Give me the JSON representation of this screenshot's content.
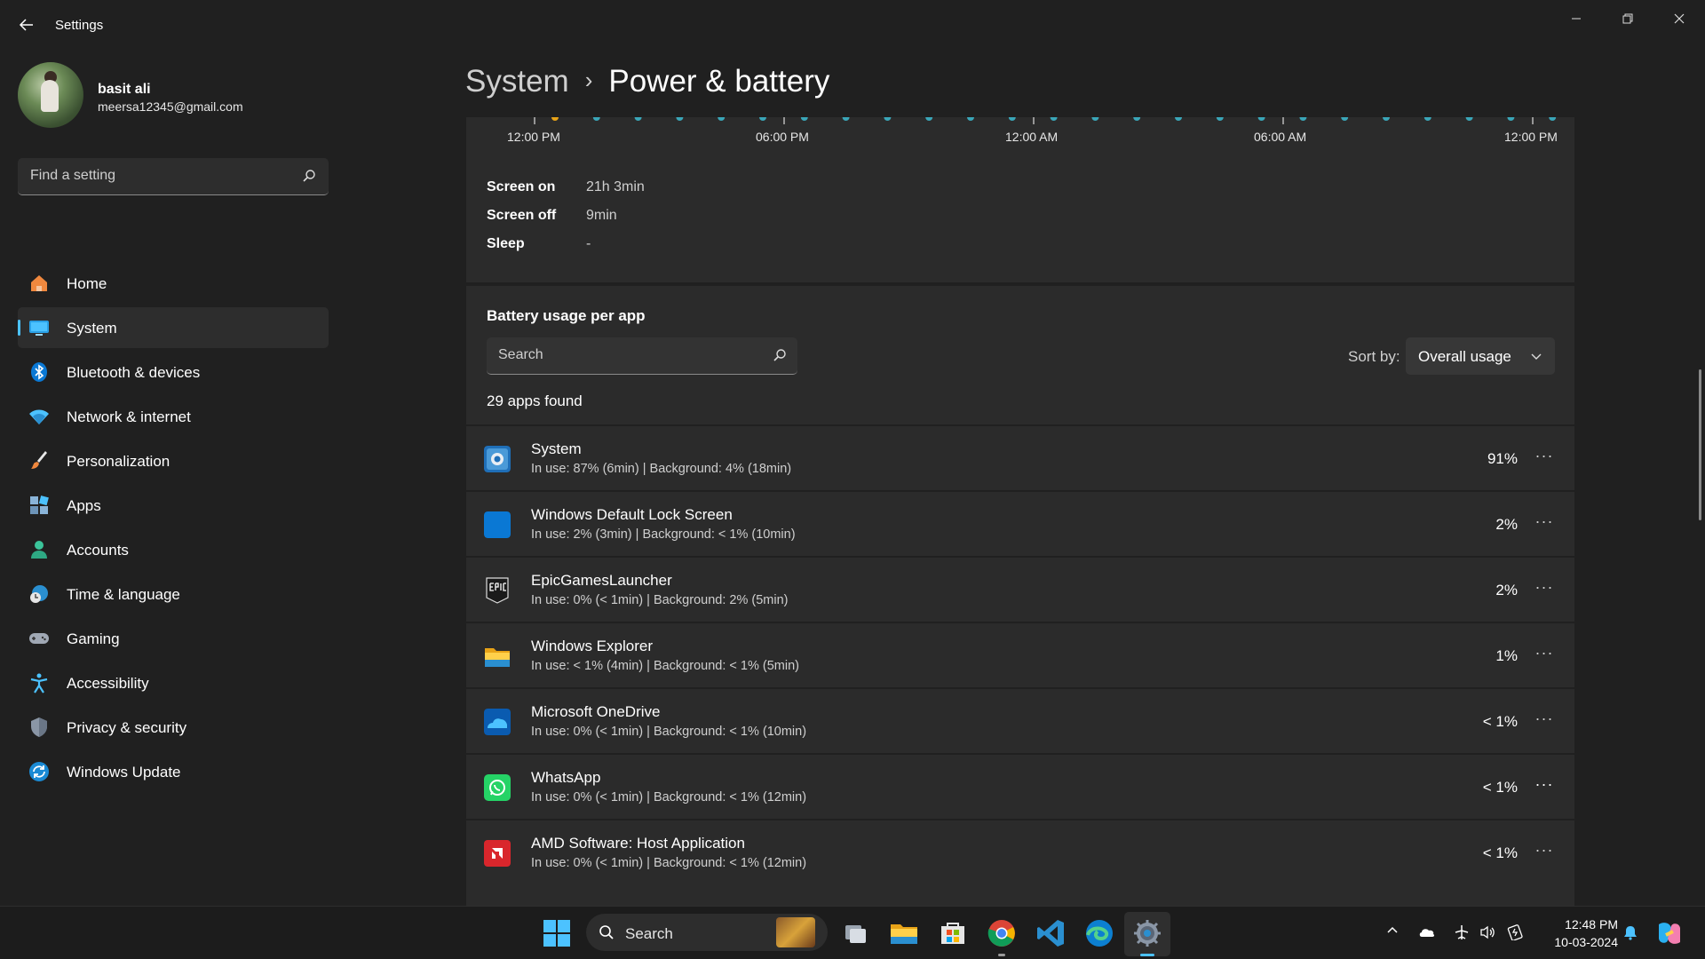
{
  "window": {
    "title": "Settings",
    "back_icon": "back-arrow-icon",
    "controls": [
      "minimize-icon",
      "restore-icon",
      "close-icon"
    ]
  },
  "profile": {
    "name": "basit ali",
    "email": "meersa12345@gmail.com"
  },
  "sidebar": {
    "search_placeholder": "Find a setting",
    "items": [
      {
        "label": "Home",
        "icon": "home-icon",
        "active": false
      },
      {
        "label": "System",
        "icon": "system-display-icon",
        "active": true
      },
      {
        "label": "Bluetooth & devices",
        "icon": "bluetooth-icon",
        "active": false
      },
      {
        "label": "Network & internet",
        "icon": "wifi-icon",
        "active": false
      },
      {
        "label": "Personalization",
        "icon": "paintbrush-icon",
        "active": false
      },
      {
        "label": "Apps",
        "icon": "apps-icon",
        "active": false
      },
      {
        "label": "Accounts",
        "icon": "account-icon",
        "active": false
      },
      {
        "label": "Time & language",
        "icon": "globe-clock-icon",
        "active": false
      },
      {
        "label": "Gaming",
        "icon": "gamepad-icon",
        "active": false
      },
      {
        "label": "Accessibility",
        "icon": "accessibility-icon",
        "active": false
      },
      {
        "label": "Privacy & security",
        "icon": "shield-icon",
        "active": false
      },
      {
        "label": "Windows Update",
        "icon": "update-icon",
        "active": false
      }
    ]
  },
  "breadcrumb": {
    "parent": "System",
    "separator": "›",
    "current": "Power & battery"
  },
  "timeline": {
    "labels": [
      "12:00 PM",
      "06:00 PM",
      "12:00 AM",
      "06:00 AM",
      "12:00 PM"
    ],
    "stats": [
      {
        "label": "Screen on",
        "value": "21h 3min"
      },
      {
        "label": "Screen off",
        "value": "9min"
      },
      {
        "label": "Sleep",
        "value": "-"
      }
    ]
  },
  "battery_usage": {
    "title": "Battery usage per app",
    "search_placeholder": "Search",
    "sort_label": "Sort by:",
    "sort_value": "Overall usage",
    "apps_found": "29 apps found",
    "apps": [
      {
        "name": "System",
        "detail": "In use: 87% (6min) | Background: 4% (18min)",
        "percent": "91%",
        "icon": "system-gear-icon"
      },
      {
        "name": "Windows Default Lock Screen",
        "detail": "In use: 2% (3min) | Background: < 1% (10min)",
        "percent": "2%",
        "icon": "lock-screen-icon"
      },
      {
        "name": "EpicGamesLauncher",
        "detail": "In use: 0% (< 1min) | Background: 2% (5min)",
        "percent": "2%",
        "icon": "epic-games-icon"
      },
      {
        "name": "Windows Explorer",
        "detail": "In use: < 1% (4min) | Background: < 1% (5min)",
        "percent": "1%",
        "icon": "folder-icon"
      },
      {
        "name": "Microsoft OneDrive",
        "detail": "In use: 0% (< 1min) | Background: < 1% (10min)",
        "percent": "< 1%",
        "icon": "onedrive-icon"
      },
      {
        "name": "WhatsApp",
        "detail": "In use: 0% (< 1min) | Background: < 1% (12min)",
        "percent": "< 1%",
        "icon": "whatsapp-icon"
      },
      {
        "name": "AMD Software: Host Application",
        "detail": "In use: 0% (< 1min) | Background: < 1% (12min)",
        "percent": "< 1%",
        "icon": "amd-icon"
      }
    ]
  },
  "taskbar": {
    "search_label": "Search",
    "clock_time": "12:48 PM",
    "clock_date": "10-03-2024"
  },
  "colors": {
    "accent": "#4cc2ff",
    "background": "#202020",
    "card": "#2b2b2b"
  }
}
